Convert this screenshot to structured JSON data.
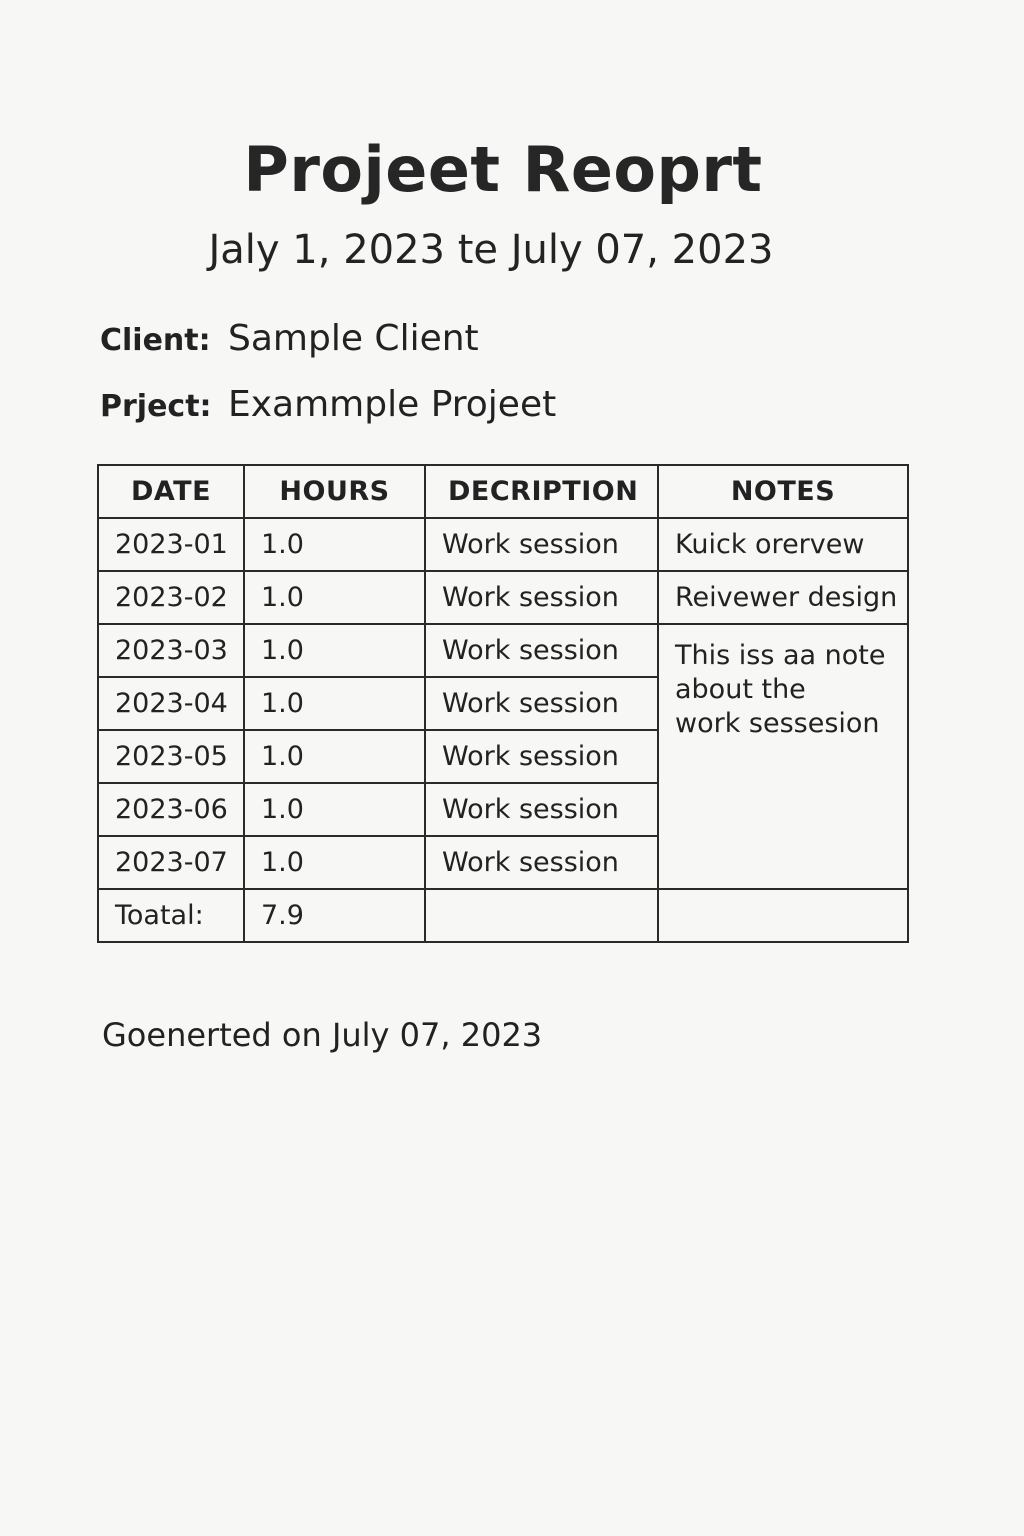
{
  "report": {
    "title": "Projeet Reoprt",
    "date_range": "Jaly 1, 2023 te July 07, 2023",
    "client_label": "Client:",
    "client_value": "Sample Client",
    "project_label": "Prject:",
    "project_value": "Exammple Projeet"
  },
  "table": {
    "headers": [
      "DATE",
      "HOURS",
      "DECRIPTION",
      "NOTES"
    ],
    "rows": [
      {
        "date": "2023-01",
        "hours": "1.0",
        "description": "Work session",
        "notes": "Kuick orervew"
      },
      {
        "date": "2023-02",
        "hours": "1.0",
        "description": "Work session",
        "notes": "Reivewer design"
      },
      {
        "date": "2023-03",
        "hours": "1.0",
        "description": "Work session"
      },
      {
        "date": "2023-04",
        "hours": "1.0",
        "description": "Work session"
      },
      {
        "date": "2023-05",
        "hours": "1.0",
        "description": "Work session"
      },
      {
        "date": "2023-06",
        "hours": "1.0",
        "description": "Work session"
      },
      {
        "date": "2023-07",
        "hours": "1.0",
        "description": "Work session"
      }
    ],
    "merged_note_lines": [
      "This iss aa note",
      "about the",
      "work sessesion"
    ],
    "total_label": "Toatal:",
    "total_hours": "7.9"
  },
  "footer": {
    "generated": "Goenerted on July 07, 2023"
  }
}
